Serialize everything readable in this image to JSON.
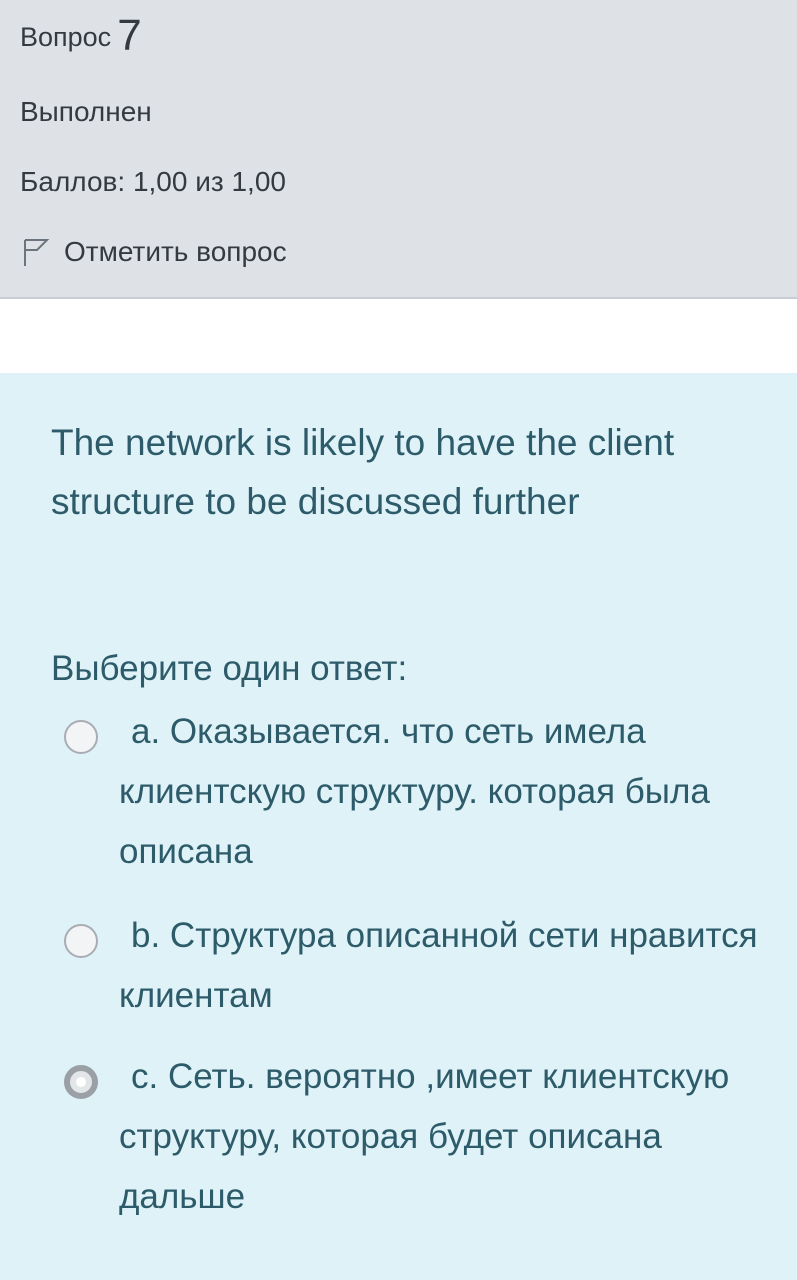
{
  "question": {
    "label": "Вопрос",
    "number": "7",
    "state": "Выполнен",
    "grade": "Баллов: 1,00 из 1,00",
    "flag_label": "Отметить вопрос",
    "flag_icon": "flag-outline-icon"
  },
  "body": {
    "text": "The network is likely to have the client structure to be discussed further",
    "prompt": "Выберите один ответ:",
    "options": [
      {
        "text": "a. Оказывается. что сеть имела клиентскую структуру. которая была описана",
        "selected": false
      },
      {
        "text": "b. Структура описанной сети нравится клиентам",
        "selected": false
      },
      {
        "text": "c. Сеть. вероятно ,имеет клиентскую структуру, которая будет описана дальше",
        "selected": true
      }
    ]
  },
  "colors": {
    "info_bg": "#dee2e6",
    "content_bg": "#def2f8",
    "text": "#2d5b6a"
  }
}
